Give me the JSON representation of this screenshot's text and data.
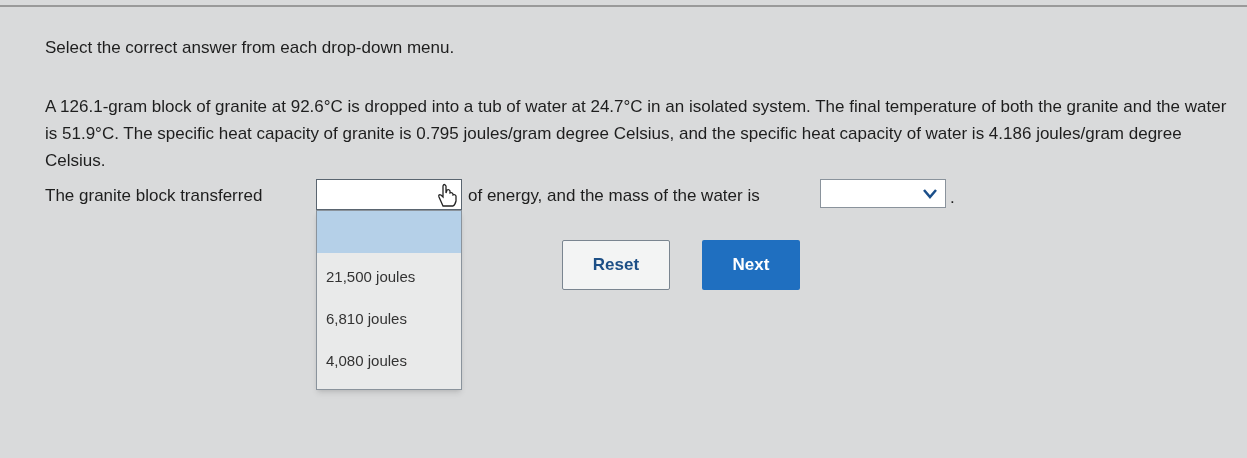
{
  "instruction": "Select the correct answer from each drop-down menu.",
  "problem": "A 126.1-gram block of granite at 92.6°C is dropped into a tub of water at 24.7°C in an isolated system. The final temperature of both the granite and the water is 51.9°C. The specific heat capacity of granite is 0.795 joules/gram degree Celsius, and the specific heat capacity of water is 4.186 joules/gram degree Celsius.",
  "sentence_parts": [
    "The granite block transferred",
    "of energy, and the mass of the water is",
    "."
  ],
  "dropdowns": [
    {
      "expanded": true,
      "blank_highlighted": true,
      "options": [
        {
          "label": "21,500 joules",
          "selected": false
        },
        {
          "label": "6,810 joules",
          "selected": false
        },
        {
          "label": "4,080 joules",
          "selected": false
        }
      ]
    },
    {
      "expanded": false
    }
  ],
  "buttons": [
    {
      "label": "Reset",
      "kind": "secondary"
    },
    {
      "label": "Next",
      "kind": "primary"
    }
  ]
}
